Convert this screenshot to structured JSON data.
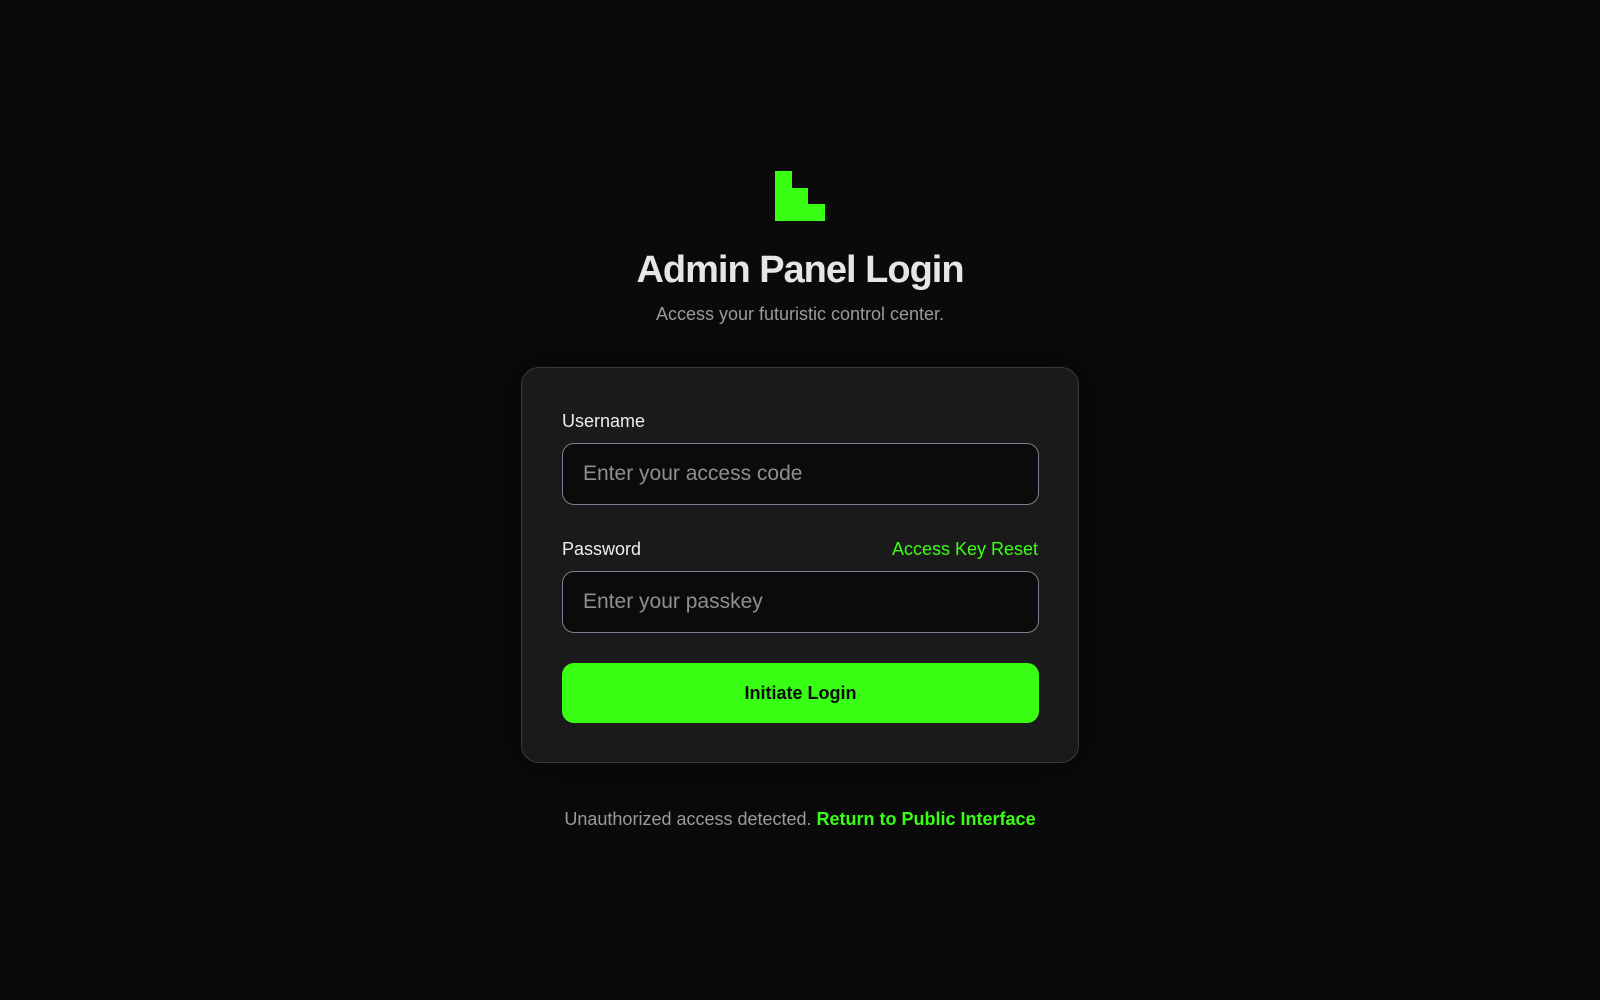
{
  "brand": {
    "logo_icon": "stair-step-logo-icon",
    "accent_color": "#39ff14"
  },
  "header": {
    "title": "Admin Panel Login",
    "subtitle": "Access your futuristic control center."
  },
  "form": {
    "username_label": "Username",
    "username_placeholder": "Enter your access code",
    "password_label": "Password",
    "password_placeholder": "Enter your passkey",
    "reset_link": "Access Key Reset",
    "submit_label": "Initiate Login"
  },
  "footer": {
    "text": "Unauthorized access detected.",
    "link": "Return to Public Interface"
  }
}
